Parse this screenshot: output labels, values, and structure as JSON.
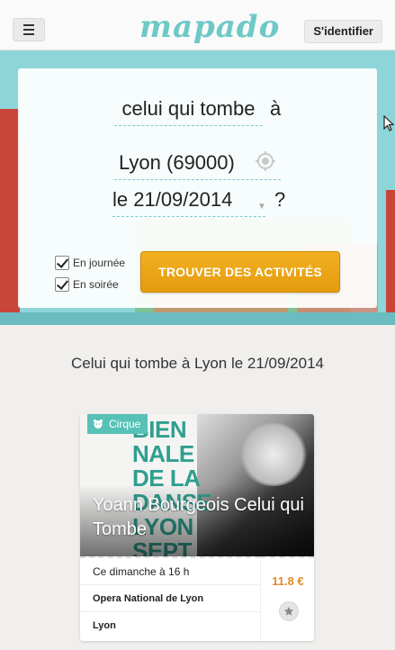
{
  "header": {
    "logo_text": "mapado",
    "login_label": "S'identifier"
  },
  "search": {
    "activity_value": "celui qui tombe",
    "connector_a": "à",
    "city_value": "Lyon (69000)",
    "date_value": "le 21/09/2014",
    "question_mark": "?",
    "option_day_label": "En journée",
    "option_evening_label": "En soirée",
    "option_day_checked": true,
    "option_evening_checked": true,
    "submit_label": "TROUVER DES ACTIVITÉS"
  },
  "results": {
    "title": "Celui qui tombe à Lyon le 21/09/2014",
    "cards": [
      {
        "category": "Cirque",
        "title": "Yoann Bourgeois Celui qui Tombe",
        "poster_text": "BIEN\nNALE\nDE LA\nDANSE\nLYON\nSEPT",
        "date_text": "Ce dimanche à 16 h",
        "venue": "Opera National de Lyon",
        "city": "Lyon",
        "price": "11.8 €"
      }
    ]
  },
  "colors": {
    "accent_teal": "#56c2b7",
    "cta_orange": "#e9a318",
    "price_orange": "#e08a2a"
  }
}
